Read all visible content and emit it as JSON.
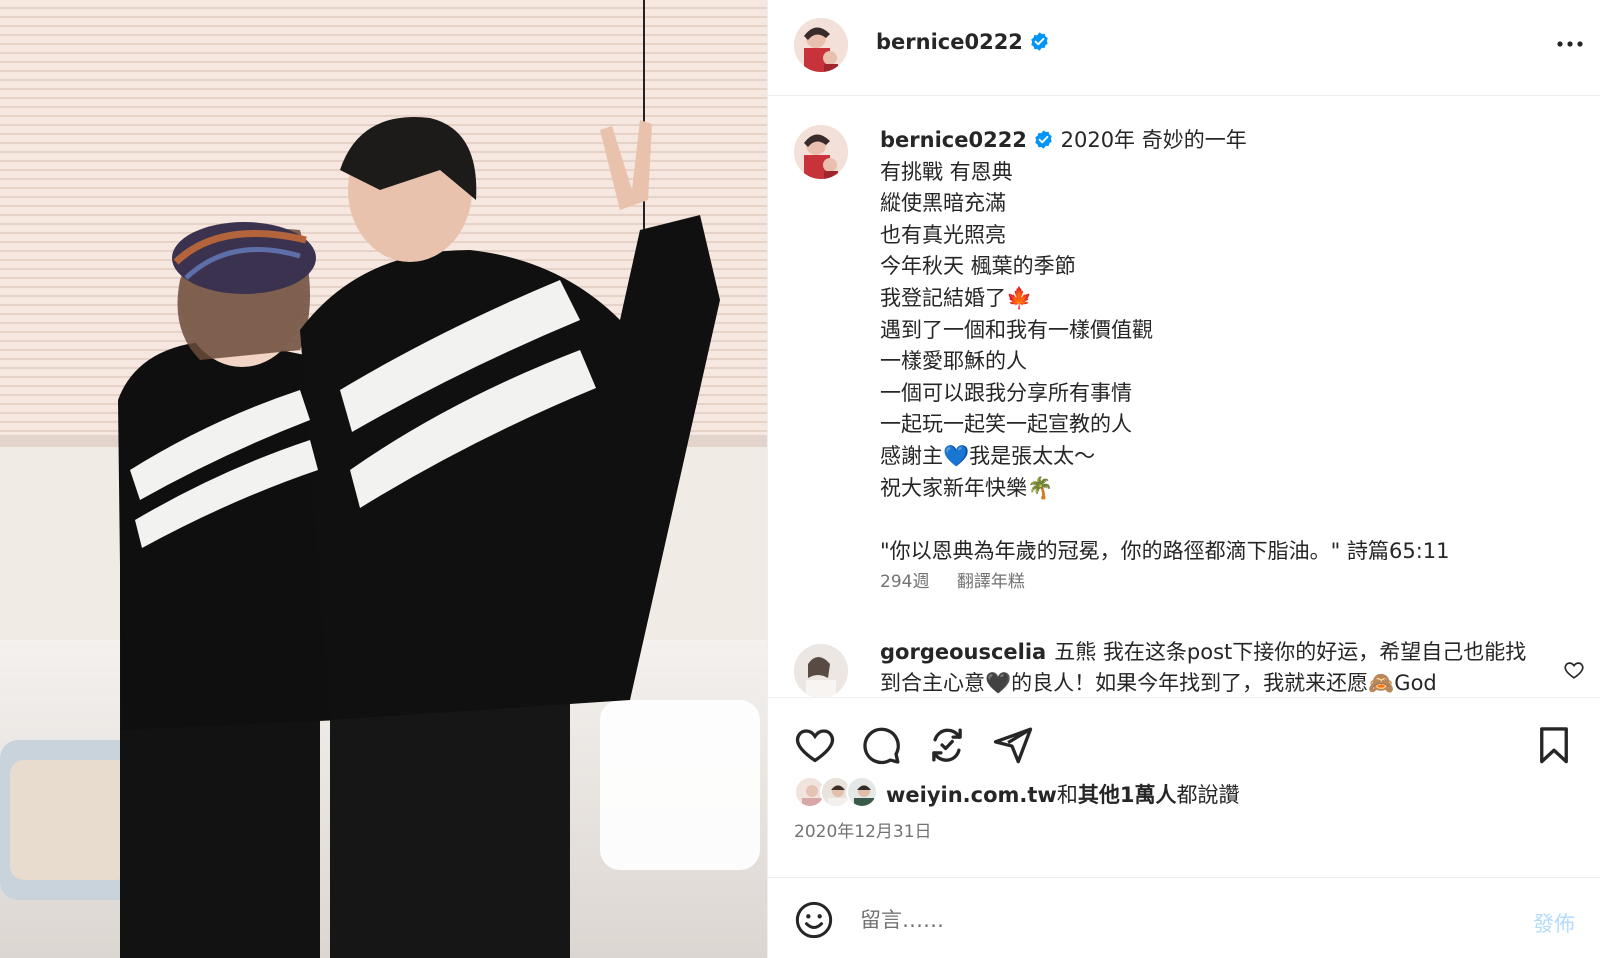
{
  "post": {
    "username": "bernice0222",
    "verified": true,
    "more_icon": "more-horizontal-icon"
  },
  "caption": {
    "username": "bernice0222",
    "first_line": "2020年 奇妙的一年",
    "lines": [
      "有挑戰 有恩典",
      "縱使黑暗充滿",
      "也有真光照亮",
      "今年秋天 楓葉的季節",
      "我登記結婚了🍁",
      "遇到了一個和我有一樣價值觀",
      "一樣愛耶穌的人",
      "一個可以跟我分享所有事情",
      "一起玩一起笑一起宣教的人",
      "感謝主💙我是張太太～",
      "祝大家新年快樂🌴",
      "",
      "\"你以恩典為年歲的冠冕，你的路徑都滴下脂油。\" 詩篇65:11"
    ],
    "time_ago": "294週",
    "translate": "翻譯年糕"
  },
  "comment": {
    "username": "gorgeouscelia",
    "text": "五熊 我在这条post下接你的好运，希望自己也能找到合主心意🖤的良人！如果今年找到了，我就来还愿🙈God"
  },
  "actions": {
    "like_icon": "heart-icon",
    "comment_icon": "comment-icon",
    "repost_icon": "repost-icon",
    "share_icon": "share-icon",
    "save_icon": "bookmark-icon"
  },
  "likes": {
    "user": "weiyin.com.tw",
    "joiner": "和",
    "others": "其他1萬人",
    "suffix": "都說讚"
  },
  "date": "2020年12月31日",
  "comment_box": {
    "placeholder": "留言……",
    "post_label": "發佈"
  },
  "colors": {
    "verified": "#0095f6",
    "muted": "#737373",
    "post_disabled": "#b3dbff"
  }
}
